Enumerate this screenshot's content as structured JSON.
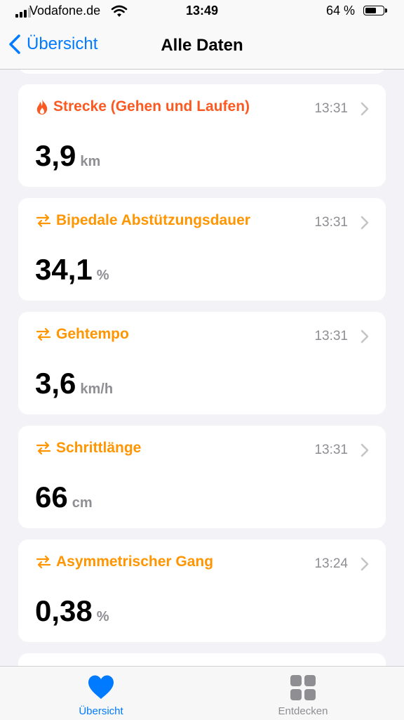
{
  "status": {
    "carrier": "Vodafone.de",
    "time": "13:49",
    "battery_percent": "64 %",
    "battery_level": 0.64
  },
  "nav": {
    "back_label": "Übersicht",
    "title": "Alle Daten"
  },
  "colors": {
    "accent_blue": "#007aff",
    "activity_red": "#fa5a22",
    "mobility_orange": "#ff9500",
    "gray_text": "#8e8e93",
    "background": "#f2f2f7"
  },
  "cards": [
    {
      "title": "Strecke (Gehen und Laufen)",
      "icon": "flame-icon",
      "color": "#fa5a22",
      "time": "13:31",
      "value": "3,9",
      "unit": "km"
    },
    {
      "title": "Bipedale Abstützungsdauer",
      "icon": "mobility-arrows-icon",
      "color": "#ff9500",
      "time": "13:31",
      "value": "34,1",
      "unit": "%"
    },
    {
      "title": "Gehtempo",
      "icon": "mobility-arrows-icon",
      "color": "#ff9500",
      "time": "13:31",
      "value": "3,6",
      "unit": "km/h"
    },
    {
      "title": "Schrittlänge",
      "icon": "mobility-arrows-icon",
      "color": "#ff9500",
      "time": "13:31",
      "value": "66",
      "unit": "cm"
    },
    {
      "title": "Asymmetrischer Gang",
      "icon": "mobility-arrows-icon",
      "color": "#ff9500",
      "time": "13:24",
      "value": "0,38",
      "unit": "%"
    }
  ],
  "tabs": [
    {
      "label": "Übersicht",
      "icon": "heart-icon",
      "active": true
    },
    {
      "label": "Entdecken",
      "icon": "grid-icon",
      "active": false
    }
  ]
}
